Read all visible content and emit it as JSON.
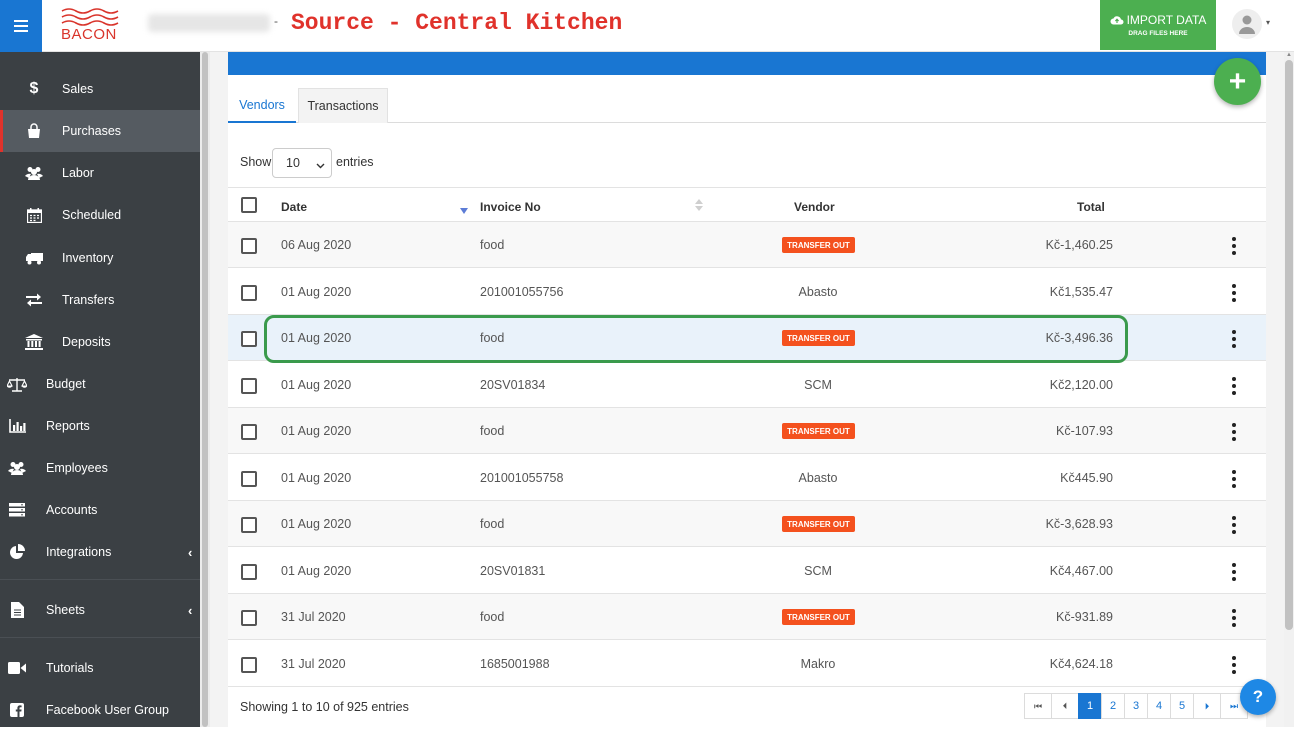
{
  "header": {
    "logo_text": "BACON",
    "location_blurred": "",
    "title": "Source - Central Kitchen",
    "import_label": "IMPORT DATA",
    "import_sub": "DRAG FILES HERE"
  },
  "sidebar": {
    "items": [
      {
        "label": "Sales",
        "icon": "dollar-icon"
      },
      {
        "label": "Purchases",
        "icon": "bag-icon"
      },
      {
        "label": "Labor",
        "icon": "users-icon"
      },
      {
        "label": "Scheduled",
        "icon": "calendar-icon"
      },
      {
        "label": "Inventory",
        "icon": "truck-icon"
      },
      {
        "label": "Transfers",
        "icon": "exchange-icon"
      },
      {
        "label": "Deposits",
        "icon": "bank-icon"
      },
      {
        "label": "Budget",
        "icon": "balance-icon"
      },
      {
        "label": "Reports",
        "icon": "bar-chart-icon"
      },
      {
        "label": "Employees",
        "icon": "users-icon"
      },
      {
        "label": "Accounts",
        "icon": "server-icon"
      },
      {
        "label": "Integrations",
        "icon": "pie-chart-icon"
      },
      {
        "label": "Sheets",
        "icon": "file-icon"
      },
      {
        "label": "Tutorials",
        "icon": "video-icon"
      },
      {
        "label": "Facebook User Group",
        "icon": "facebook-icon"
      }
    ]
  },
  "tabs": [
    {
      "label": "Vendors"
    },
    {
      "label": "Transactions"
    }
  ],
  "length_menu": {
    "show": "Show",
    "value": "10",
    "entries": "entries"
  },
  "table": {
    "columns": [
      "Date",
      "Invoice No",
      "Vendor",
      "Total"
    ],
    "badge_label": "TRANSFER OUT",
    "rows": [
      {
        "date": "06 Aug 2020",
        "invoice": "food",
        "vendor": "TRANSFER OUT",
        "badge": true,
        "total": "Kč-1,460.25"
      },
      {
        "date": "01 Aug 2020",
        "invoice": "201001055756",
        "vendor": "Abasto",
        "badge": false,
        "total": "Kč1,535.47"
      },
      {
        "date": "01 Aug 2020",
        "invoice": "food",
        "vendor": "TRANSFER OUT",
        "badge": true,
        "total": "Kč-3,496.36"
      },
      {
        "date": "01 Aug 2020",
        "invoice": "20SV01834",
        "vendor": "SCM",
        "badge": false,
        "total": "Kč2,120.00"
      },
      {
        "date": "01 Aug 2020",
        "invoice": "food",
        "vendor": "TRANSFER OUT",
        "badge": true,
        "total": "Kč-107.93"
      },
      {
        "date": "01 Aug 2020",
        "invoice": "201001055758",
        "vendor": "Abasto",
        "badge": false,
        "total": "Kč445.90"
      },
      {
        "date": "01 Aug 2020",
        "invoice": "food",
        "vendor": "TRANSFER OUT",
        "badge": true,
        "total": "Kč-3,628.93"
      },
      {
        "date": "01 Aug 2020",
        "invoice": "20SV01831",
        "vendor": "SCM",
        "badge": false,
        "total": "Kč4,467.00"
      },
      {
        "date": "31 Jul 2020",
        "invoice": "food",
        "vendor": "TRANSFER OUT",
        "badge": true,
        "total": "Kč-931.89"
      },
      {
        "date": "31 Jul 2020",
        "invoice": "1685001988",
        "vendor": "Makro",
        "badge": false,
        "total": "Kč4,624.18"
      }
    ]
  },
  "footer": {
    "info": "Showing 1 to 10 of 925 entries",
    "pages": [
      "1",
      "2",
      "3",
      "4",
      "5"
    ],
    "current_page": "1"
  },
  "colors": {
    "brand_blue": "#1976d2",
    "import_green": "#4caf50",
    "badge_orange": "#f4511e",
    "sidebar_bg": "#3b4044",
    "title_red": "#e0322b",
    "highlight_green": "#3a9a4c"
  }
}
